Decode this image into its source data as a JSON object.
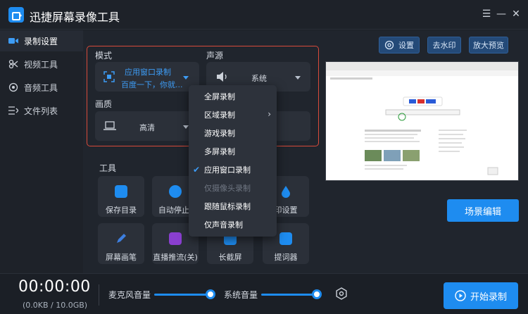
{
  "app": {
    "title": "迅捷屏幕录像工具"
  },
  "sidebar": {
    "items": [
      {
        "label": "录制设置",
        "icon": "video-camera-icon",
        "active": true
      },
      {
        "label": "视频工具",
        "icon": "video-tools-icon",
        "active": false
      },
      {
        "label": "音频工具",
        "icon": "audio-tools-icon",
        "active": false
      },
      {
        "label": "文件列表",
        "icon": "file-list-icon",
        "active": false
      }
    ]
  },
  "toolbar": {
    "settings_label": "设置",
    "watermark_label": "去水印",
    "preview_label": "放大预览"
  },
  "record_settings": {
    "mode_label": "模式",
    "mode_value": "应用窗口录制",
    "mode_sub": "百度一下，你就...",
    "source_label": "声源",
    "source_value": "系统",
    "quality_label": "画质",
    "quality_value": "高清"
  },
  "mode_menu": {
    "items": [
      {
        "label": "全屏录制",
        "checked": false,
        "disabled": false,
        "submenu": false
      },
      {
        "label": "区域录制",
        "checked": false,
        "disabled": false,
        "submenu": true
      },
      {
        "label": "游戏录制",
        "checked": false,
        "disabled": false,
        "submenu": false
      },
      {
        "label": "多屏录制",
        "checked": false,
        "disabled": false,
        "submenu": false
      },
      {
        "label": "应用窗口录制",
        "checked": true,
        "disabled": false,
        "submenu": false
      },
      {
        "label": "仅摄像头录制",
        "checked": false,
        "disabled": true,
        "submenu": false
      },
      {
        "label": "跟随鼠标录制",
        "checked": false,
        "disabled": false,
        "submenu": false
      },
      {
        "label": "仅声音录制",
        "checked": false,
        "disabled": false,
        "submenu": false
      }
    ],
    "submenu_arrow": "›",
    "check_mark": "✔"
  },
  "tools": {
    "section_label": "工具",
    "items": [
      {
        "label": "保存目录",
        "icon": "folder-download-icon"
      },
      {
        "label": "自动停止(",
        "icon": "auto-stop-icon"
      },
      {
        "label": "印设置",
        "icon": "watermark-drop-icon"
      },
      {
        "label": "屏幕画笔",
        "icon": "pen-icon"
      },
      {
        "label": "直播推流(关)",
        "icon": "live-tv-icon"
      },
      {
        "label": "长截屏",
        "icon": "long-screenshot-icon"
      },
      {
        "label": "提词器",
        "icon": "teleprompter-icon"
      }
    ]
  },
  "preview_panel": {
    "scene_edit_label": "场景编辑"
  },
  "status": {
    "timer": "00:00:00",
    "size": "(0.0KB / 10.0GB)",
    "mic_label": "麦克风音量",
    "mic_level": 1.0,
    "system_label": "系统音量",
    "system_level": 1.0,
    "start_label": "开始录制"
  },
  "colors": {
    "accent": "#1e8cf0",
    "highlight_border": "#d84a3a",
    "background": "#20252d"
  }
}
